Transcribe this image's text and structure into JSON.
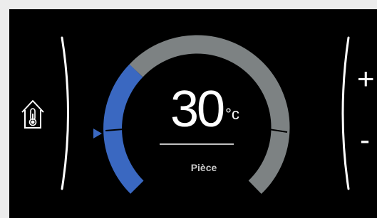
{
  "thermostat": {
    "temperature": "30",
    "unit": "°c",
    "mode_label": "Pièce",
    "setpoint_fraction": 0.33
  },
  "controls": {
    "increase_label": "+",
    "decrease_label": "-"
  },
  "icons": {
    "mode": "house-thermometer-icon",
    "pointer": "triangle-pointer-icon"
  },
  "colors": {
    "active_arc": "#3a68c1",
    "inactive_arc": "#7d8283",
    "background": "#000000",
    "frame": "#ececec"
  }
}
